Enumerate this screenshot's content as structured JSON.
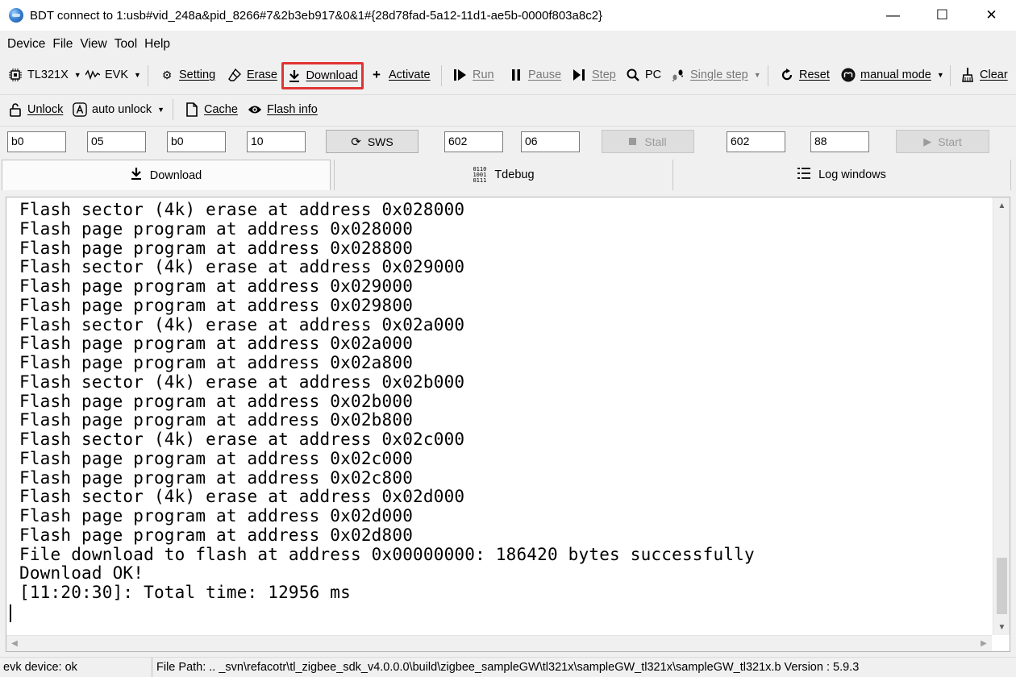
{
  "window": {
    "title": "BDT connect to 1:usb#vid_248a&pid_8266#7&2b3eb917&0&1#{28d78fad-5a12-11d1-ae5b-0000f803a8c2}",
    "minimize_glyph": "—",
    "maximize_glyph": "☐",
    "close_glyph": "✕"
  },
  "menu": [
    "Device",
    "File",
    "View",
    "Tool",
    "Help"
  ],
  "toolbar": {
    "chip": "TL321X",
    "board": "EVK",
    "setting": "Setting",
    "erase": "Erase",
    "download": "Download",
    "activate": "Activate",
    "run": "Run",
    "pause": "Pause",
    "step": "Step",
    "pc": "PC",
    "single_step": "Single step",
    "reset": "Reset",
    "manual_mode": "manual mode",
    "clear": "Clear"
  },
  "toolbar2": {
    "unlock": "Unlock",
    "auto_unlock": "auto unlock",
    "cache": "Cache",
    "flash_info": "Flash info"
  },
  "registers": {
    "r1": "b0",
    "r2": "05",
    "r3": "b0",
    "r4": "10",
    "sws": "SWS",
    "r5": "602",
    "r6": "06",
    "stall": "Stall",
    "r7": "602",
    "r8": "88",
    "start": "Start"
  },
  "tabs": [
    "Download",
    "Tdebug",
    "Log windows"
  ],
  "log": [
    "Flash sector (4k) erase at address 0x028000",
    "Flash page program at address 0x028000",
    "Flash page program at address 0x028800",
    "Flash sector (4k) erase at address 0x029000",
    "Flash page program at address 0x029000",
    "Flash page program at address 0x029800",
    "Flash sector (4k) erase at address 0x02a000",
    "Flash page program at address 0x02a000",
    "Flash page program at address 0x02a800",
    "Flash sector (4k) erase at address 0x02b000",
    "Flash page program at address 0x02b000",
    "Flash page program at address 0x02b800",
    "Flash sector (4k) erase at address 0x02c000",
    "Flash page program at address 0x02c000",
    "Flash page program at address 0x02c800",
    "Flash sector (4k) erase at address 0x02d000",
    "Flash page program at address 0x02d000",
    "Flash page program at address 0x02d800",
    "File download to flash at address 0x00000000: 186420 bytes successfully",
    "Download OK!",
    "[11:20:30]: Total time: 12956 ms"
  ],
  "status": {
    "device": "evk device: ok",
    "path": "File Path:   ..  _svn\\refacotr\\tl_zigbee_sdk_v4.0.0.0\\build\\zigbee_sampleGW\\tl321x\\sampleGW_tl321x\\sampleGW_tl321x.b Version : 5.9.3"
  },
  "colors": {
    "highlight": "#e03434",
    "background": "#f0f0f0"
  }
}
